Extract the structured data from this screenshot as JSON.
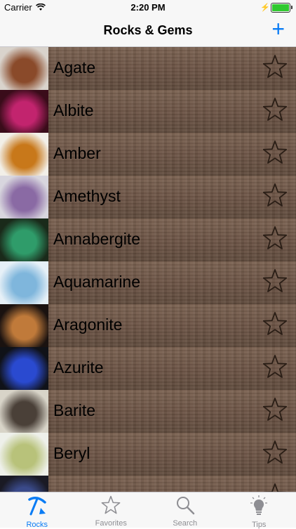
{
  "status_bar": {
    "carrier": "Carrier",
    "time": "2:20 PM"
  },
  "nav": {
    "title": "Rocks & Gems",
    "add_icon": "plus-icon"
  },
  "colors": {
    "accent": "#0a7cf5",
    "row_wood": "#6c5445",
    "inactive_tab": "#8e8e93"
  },
  "rows": [
    {
      "name": "Agate",
      "thumb": [
        "#d9d3cc",
        "#8a4a2a"
      ]
    },
    {
      "name": "Albite",
      "thumb": [
        "#3a0c1a",
        "#c2246e"
      ]
    },
    {
      "name": "Amber",
      "thumb": [
        "#f2efe8",
        "#c8781a"
      ]
    },
    {
      "name": "Amethyst",
      "thumb": [
        "#d8d6de",
        "#8a6aa4"
      ]
    },
    {
      "name": "Annabergite",
      "thumb": [
        "#1a2a1a",
        "#2f9c6a"
      ]
    },
    {
      "name": "Aquamarine",
      "thumb": [
        "#e6f0f7",
        "#7fb6dc"
      ]
    },
    {
      "name": "Aragonite",
      "thumb": [
        "#1a1210",
        "#c07a3a"
      ]
    },
    {
      "name": "Azurite",
      "thumb": [
        "#101218",
        "#2a4ad0"
      ]
    },
    {
      "name": "Barite",
      "thumb": [
        "#d8d4c8",
        "#4a4038"
      ]
    },
    {
      "name": "Beryl",
      "thumb": [
        "#eef0ea",
        "#b8c27a"
      ]
    },
    {
      "name": "",
      "thumb": [
        "#1a1a24",
        "#3a4a8a"
      ]
    }
  ],
  "tabs": [
    {
      "label": "Rocks",
      "icon": "pickaxe-icon",
      "active": true
    },
    {
      "label": "Favorites",
      "icon": "star-icon",
      "active": false
    },
    {
      "label": "Search",
      "icon": "magnifier-icon",
      "active": false
    },
    {
      "label": "Tips",
      "icon": "lightbulb-icon",
      "active": false
    }
  ]
}
